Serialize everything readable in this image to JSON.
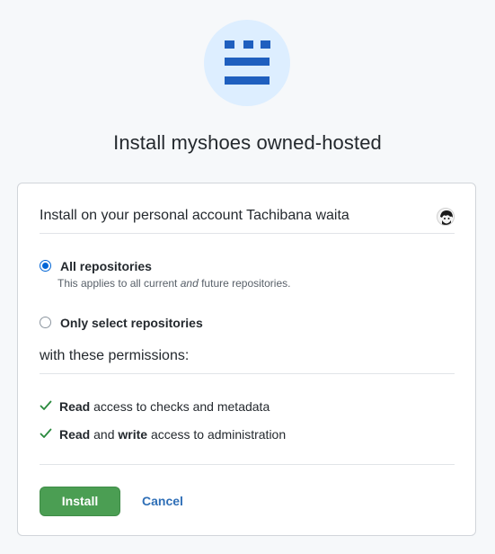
{
  "app": {
    "title": "Install myshoes owned-hosted",
    "logo_icon": "myshoes-logo-icon",
    "logo_bg": "#ddeeff",
    "logo_color": "#1f5fbf"
  },
  "account": {
    "install_on": "Install on your personal account Tachibana waita",
    "avatar_icon": "user-avatar"
  },
  "repositories": {
    "all_label": "All repositories",
    "all_note_before": "This applies to all current ",
    "all_note_em": "and",
    "all_note_after": " future repositories.",
    "select_label": "Only select repositories",
    "selected": "all"
  },
  "permissions": {
    "heading": "with these permissions:",
    "items": [
      {
        "b1": "Read",
        "t1": " access to checks and metadata",
        "b2": "",
        "t2": ""
      },
      {
        "b1": "Read",
        "t1": " and ",
        "b2": "write",
        "t2": " access to administration"
      }
    ],
    "check_color": "#2a8a3e"
  },
  "actions": {
    "install_label": "Install",
    "cancel_label": "Cancel",
    "install_color": "#4b9e53",
    "cancel_color": "#2f6fb7"
  }
}
